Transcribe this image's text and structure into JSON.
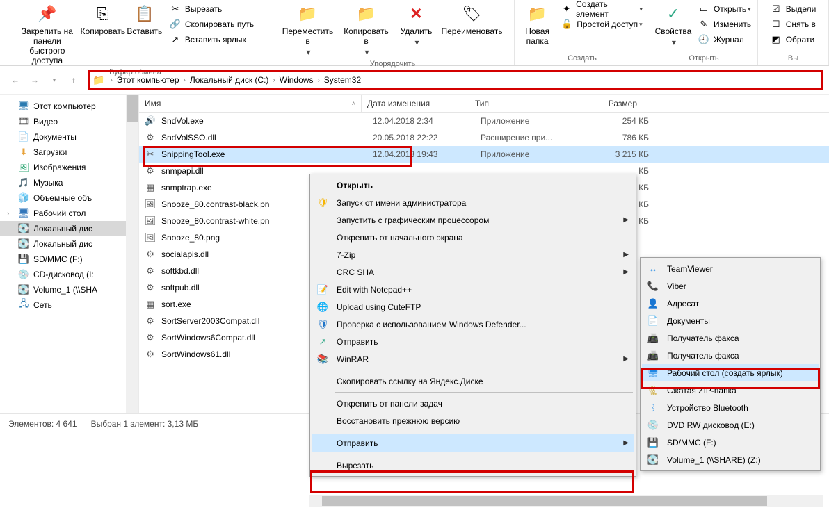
{
  "ribbon": {
    "groups": {
      "clipboard": {
        "label": "Буфер обмена",
        "pin": "Закрепить на панели\nбыстрого доступа",
        "copy": "Копировать",
        "paste": "Вставить",
        "cut": "Вырезать",
        "copypath": "Скопировать путь",
        "pastelnk": "Вставить ярлык"
      },
      "organize": {
        "label": "Упорядочить",
        "moveto": "Переместить\nв",
        "copyto": "Копировать\nв",
        "delete": "Удалить",
        "rename": "Переименовать"
      },
      "create": {
        "label": "Создать",
        "newfolder": "Новая\nпапка",
        "newitem": "Создать элемент",
        "easyaccess": "Простой доступ"
      },
      "open": {
        "label": "Открыть",
        "props": "Свойства",
        "open": "Открыть",
        "edit": "Изменить",
        "history": "Журнал"
      },
      "select": {
        "selectall": "Выдели",
        "deselect": "Снять в",
        "invert": "Обрати"
      }
    }
  },
  "breadcrumbs": [
    "Этот компьютер",
    "Локальный диск (C:)",
    "Windows",
    "System32"
  ],
  "sidebar": [
    {
      "label": "Этот компьютер",
      "icon": "🖥",
      "color": "#2a7ab0"
    },
    {
      "label": "Видео",
      "icon": "🎞",
      "color": "#555"
    },
    {
      "label": "Документы",
      "icon": "📄",
      "color": "#3a7"
    },
    {
      "label": "Загрузки",
      "icon": "⬇",
      "color": "#e8a23a"
    },
    {
      "label": "Изображения",
      "icon": "🖼",
      "color": "#3a7"
    },
    {
      "label": "Музыка",
      "icon": "🎵",
      "color": "#37b"
    },
    {
      "label": "Объемные объ",
      "icon": "🧊",
      "color": "#37b"
    },
    {
      "label": "Рабочий стол",
      "icon": "🖥",
      "color": "#37b",
      "exp": "›"
    },
    {
      "label": "Локальный дис",
      "icon": "💽",
      "selected": true
    },
    {
      "label": "Локальный дис",
      "icon": "💽"
    },
    {
      "label": "SD/MMC (F:)",
      "icon": "💾",
      "color": "#26c"
    },
    {
      "label": "CD-дисковод (I:",
      "icon": "💿"
    },
    {
      "label": "Volume_1 (\\\\SHA",
      "icon": "💽"
    },
    {
      "label": "Сеть",
      "icon": "🖧",
      "color": "#2a7ab0"
    }
  ],
  "columns": {
    "name": "Имя",
    "date": "Дата изменения",
    "type": "Тип",
    "size": "Размер"
  },
  "rows": [
    {
      "icon": "🔊",
      "name": "SndVol.exe",
      "date": "12.04.2018 2:34",
      "type": "Приложение",
      "size": "254 КБ"
    },
    {
      "icon": "⚙",
      "name": "SndVolSSO.dll",
      "date": "20.05.2018 22:22",
      "type": "Расширение при...",
      "size": "786 КБ"
    },
    {
      "icon": "✂",
      "name": "SnippingTool.exe",
      "date": "12.04.2018 19:43",
      "type": "Приложение",
      "size": "3 215 КБ",
      "sel": true
    },
    {
      "icon": "⚙",
      "name": "snmpapi.dll",
      "date": "",
      "type": "",
      "size": "КБ"
    },
    {
      "icon": "▦",
      "name": "snmptrap.exe",
      "date": "",
      "type": "",
      "size": "КБ"
    },
    {
      "icon": "🖼",
      "name": "Snooze_80.contrast-black.pn",
      "date": "",
      "type": "",
      "size": "КБ"
    },
    {
      "icon": "🖼",
      "name": "Snooze_80.contrast-white.pn",
      "date": "",
      "type": "",
      "size": "КБ"
    },
    {
      "icon": "🖼",
      "name": "Snooze_80.png",
      "date": "",
      "type": "",
      "size": ""
    },
    {
      "icon": "⚙",
      "name": "socialapis.dll",
      "date": "",
      "type": "",
      "size": ""
    },
    {
      "icon": "⚙",
      "name": "softkbd.dll",
      "date": "",
      "type": "",
      "size": ""
    },
    {
      "icon": "⚙",
      "name": "softpub.dll",
      "date": "",
      "type": "",
      "size": ""
    },
    {
      "icon": "▦",
      "name": "sort.exe",
      "date": "",
      "type": "",
      "size": ""
    },
    {
      "icon": "⚙",
      "name": "SortServer2003Compat.dll",
      "date": "",
      "type": "",
      "size": ""
    },
    {
      "icon": "⚙",
      "name": "SortWindows6Compat.dll",
      "date": "",
      "type": "",
      "size": ""
    },
    {
      "icon": "⚙",
      "name": "SortWindows61.dll",
      "date": "",
      "type": "",
      "size": ""
    }
  ],
  "status": {
    "items": "Элементов: 4 641",
    "selected": "Выбран 1 элемент: 3,13 МБ"
  },
  "context_main": [
    {
      "label": "Открыть",
      "bold": true
    },
    {
      "label": "Запуск от имени администратора",
      "icon": "🛡",
      "iconcolor": "#f5b300"
    },
    {
      "label": "Запустить с графическим процессором",
      "arrow": true
    },
    {
      "label": "Открепить от начального экрана"
    },
    {
      "label": "7-Zip",
      "arrow": true
    },
    {
      "label": "CRC SHA",
      "arrow": true
    },
    {
      "label": "Edit with Notepad++",
      "icon": "📝",
      "iconcolor": "#5a9"
    },
    {
      "label": "Upload using CuteFTP",
      "icon": "🌐",
      "iconcolor": "#4a8"
    },
    {
      "label": "Проверка с использованием Windows Defender...",
      "icon": "🛡",
      "iconcolor": "#1e74c8"
    },
    {
      "label": "Отправить",
      "icon": "↗",
      "iconcolor": "#3a8"
    },
    {
      "label": "WinRAR",
      "icon": "📚",
      "iconcolor": "#8a5",
      "arrow": true
    },
    {
      "sep": true
    },
    {
      "label": "Скопировать ссылку на Яндекс.Диске"
    },
    {
      "sep": true
    },
    {
      "label": "Открепить от панели задач"
    },
    {
      "label": "Восстановить прежнюю версию"
    },
    {
      "sep": true
    },
    {
      "label": "Отправить",
      "arrow": true,
      "hl": true
    },
    {
      "sep": true
    },
    {
      "label": "Вырезать"
    }
  ],
  "context_sub": [
    {
      "label": "TeamViewer",
      "icon": "↔",
      "iconcolor": "#1e88e5"
    },
    {
      "label": "Viber",
      "icon": "📞",
      "iconcolor": "#7b519d"
    },
    {
      "label": "Адресат",
      "icon": "👤"
    },
    {
      "label": "Документы",
      "icon": "📄"
    },
    {
      "label": "Получатель факса",
      "icon": "📠"
    },
    {
      "label": "Получатель факса",
      "icon": "📠"
    },
    {
      "label": "Рабочий стол (создать ярлык)",
      "icon": "🖥",
      "iconcolor": "#1e88e5",
      "hl": true
    },
    {
      "label": "Сжатая ZIP-папка",
      "icon": "🗜",
      "iconcolor": "#c9a227"
    },
    {
      "label": "Устройство Bluetooth",
      "icon": "ᛒ",
      "iconcolor": "#1e88e5"
    },
    {
      "label": "DVD RW дисковод (E:)",
      "icon": "💿"
    },
    {
      "label": "SD/MMC (F:)",
      "icon": "💾",
      "iconcolor": "#26c"
    },
    {
      "label": "Volume_1 (\\\\SHARE) (Z:)",
      "icon": "💽"
    }
  ]
}
